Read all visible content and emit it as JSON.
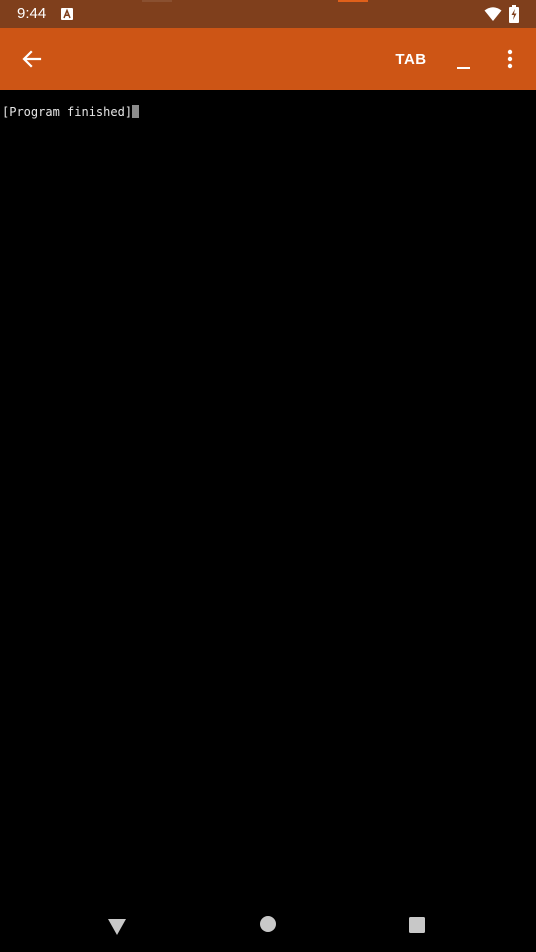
{
  "status_bar": {
    "time": "9:44",
    "background": "#7f3f1c",
    "icons": [
      "text-input-icon",
      "wifi-icon",
      "battery-charging-icon"
    ]
  },
  "app_bar": {
    "background": "#cd5515",
    "back_icon": "arrow-left-icon",
    "tab_label": "TAB",
    "minimize_label": "_",
    "more_icon": "more-vertical-icon"
  },
  "terminal": {
    "background": "#000000",
    "text_color": "#e6e6e6",
    "output": "[Program finished]"
  },
  "nav_bar": {
    "icons": [
      "nav-back-icon",
      "nav-home-icon",
      "nav-recents-icon"
    ]
  }
}
